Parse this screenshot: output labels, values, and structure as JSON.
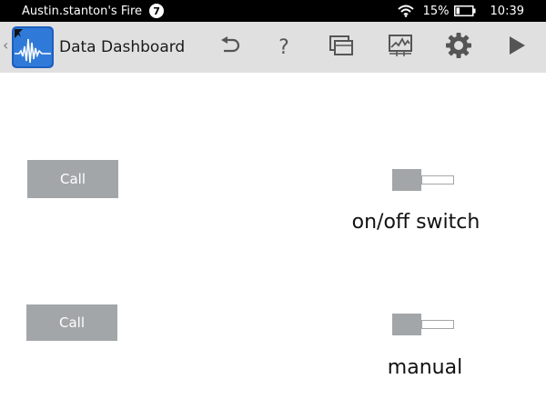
{
  "status_bar": {
    "device_name": "Austin.stanton's Fire",
    "notification_count": "7",
    "battery_percent": "15%",
    "time": "10:39",
    "icons": [
      "wifi-icon",
      "battery-icon"
    ]
  },
  "action_bar": {
    "title": "Data Dashboard",
    "help_label": "?",
    "icons": [
      "app-logo-icon",
      "undo-icon",
      "help-icon",
      "copy-icon",
      "chart-icon",
      "gear-icon",
      "play-icon"
    ]
  },
  "widgets": [
    {
      "button_label": "Call",
      "switch_label": "on/off switch",
      "switch_state": "off"
    },
    {
      "button_label": "Call",
      "switch_label": "manual",
      "switch_state": "off"
    }
  ],
  "colors": {
    "status_bar_bg": "#000000",
    "action_bar_bg": "#e0e0e0",
    "control_gray": "#a3a6a8",
    "icon_gray": "#555555"
  }
}
